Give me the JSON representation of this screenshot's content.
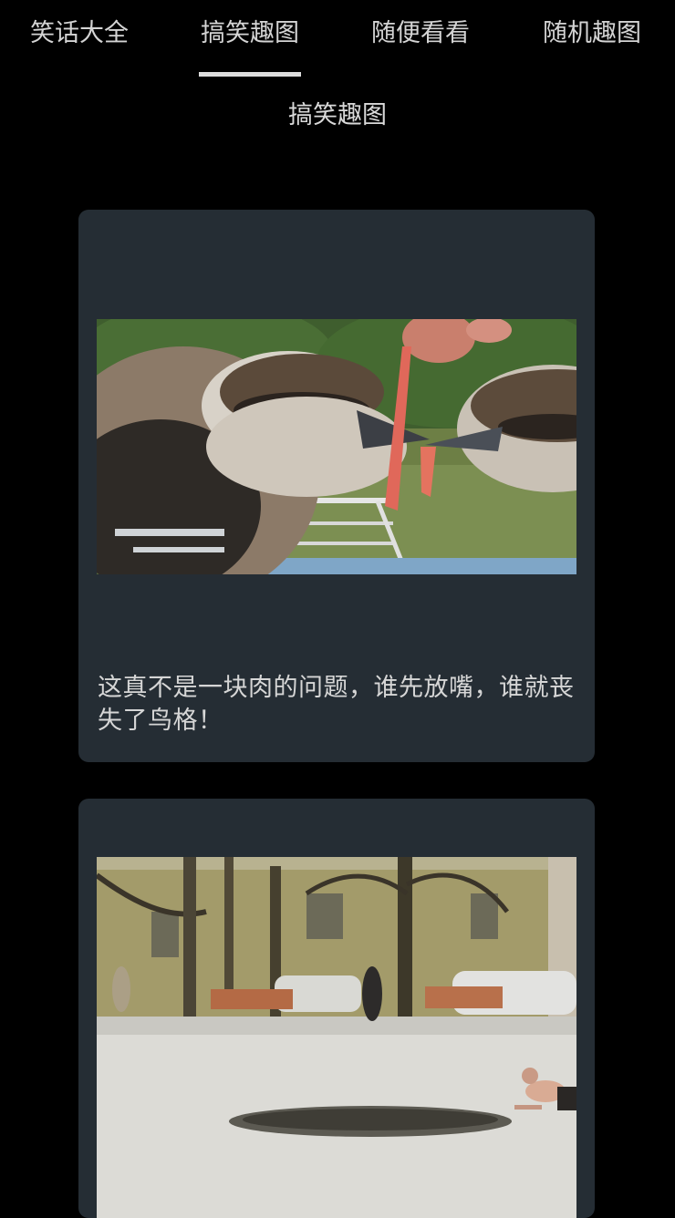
{
  "tabs": [
    {
      "label": "笑话大全",
      "active": false
    },
    {
      "label": "搞笑趣图",
      "active": true
    },
    {
      "label": "随便看看",
      "active": false
    },
    {
      "label": "随机趣图",
      "active": false
    }
  ],
  "page_title": "搞笑趣图",
  "feed": [
    {
      "caption": "这真不是一块肉的问题，谁先放嘴，谁就丧失了鸟格！"
    },
    {
      "caption": ""
    }
  ],
  "colors": {
    "background": "#000000",
    "card": "#252d34",
    "text": "#d9d9d9",
    "indicator": "#dcdcdc"
  }
}
